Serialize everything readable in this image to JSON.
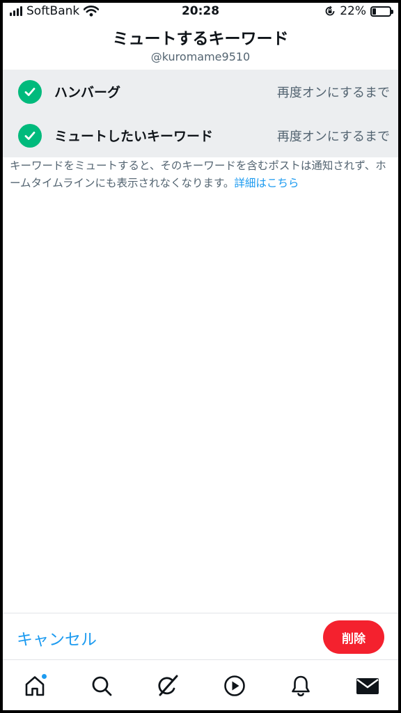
{
  "status_bar": {
    "carrier": "SoftBank",
    "time": "20:28",
    "battery": "22%",
    "battery_level": 0.22
  },
  "header": {
    "title": "ミュートするキーワード",
    "account": "@kuromame9510"
  },
  "keywords": [
    {
      "label": "ハンバーグ",
      "duration": "再度オンにするまで"
    },
    {
      "label": "ミュートしたいキーワード",
      "duration": "再度オンにするまで"
    }
  ],
  "description": {
    "text": "キーワードをミュートすると、そのキーワードを含むポストは通知されず、ホームタイムラインにも表示されなくなります。",
    "link": "詳細はこちら"
  },
  "actions": {
    "cancel": "キャンセル",
    "delete": "削除"
  },
  "colors": {
    "accent": "#1d9bf0",
    "check": "#00ba7c",
    "delete": "#f4212e"
  },
  "tab_bar": {
    "icons": [
      "home-icon",
      "search-icon",
      "grok-icon",
      "video-icon",
      "notifications-icon",
      "messages-icon"
    ]
  }
}
